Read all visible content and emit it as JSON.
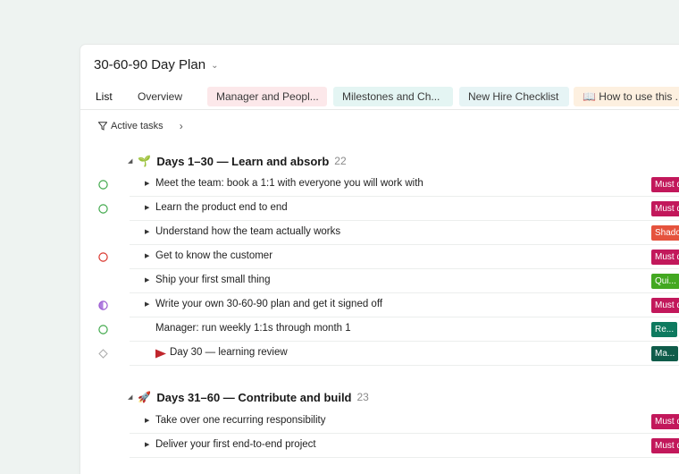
{
  "document": {
    "title": "30-60-90 Day Plan"
  },
  "tabs": [
    {
      "label": "List",
      "style": "active",
      "bg": ""
    },
    {
      "label": "Overview",
      "style": "plain",
      "bg": ""
    },
    {
      "label": "Manager and Peopl...",
      "style": "pill",
      "bg": "#fce8ea"
    },
    {
      "label": "Milestones and Ch...",
      "style": "pill",
      "bg": "#e4f5f3"
    },
    {
      "label": "New Hire Checklist",
      "style": "pill",
      "bg": "#e6f4f5"
    },
    {
      "label": "📖 How to use this ...",
      "style": "pill",
      "bg": "#fdf0e0"
    }
  ],
  "filter": {
    "label": "Active tasks",
    "more": "›"
  },
  "groups": [
    {
      "emoji": "🌱",
      "title": "Days 1–30 — Learn and absorb",
      "count": "22"
    },
    {
      "emoji": "🚀",
      "title": "Days 31–60 — Contribute and build",
      "count": "23"
    }
  ],
  "rows": [
    {
      "label": "Meet the team: book a 1:1 with everyone you will work with",
      "status": "open-green",
      "caret": true,
      "flag": false,
      "tag": "Must do",
      "tag_color": "#c2185b"
    },
    {
      "label": "Learn the product end to end",
      "status": "open-green",
      "caret": true,
      "flag": false,
      "tag": "Must do",
      "tag_color": "#c2185b"
    },
    {
      "label": "Understand how the team actually works",
      "status": "none",
      "caret": true,
      "flag": false,
      "tag": "Shadow",
      "tag_color": "#e5533d"
    },
    {
      "label": "Get to know the customer",
      "status": "open-red",
      "caret": true,
      "flag": false,
      "tag": "Must do",
      "tag_color": "#c2185b"
    },
    {
      "label": "Ship your first small thing",
      "status": "none",
      "caret": true,
      "flag": false,
      "tag": "Qui...",
      "tag_color": "#43a821"
    },
    {
      "label": "Write your own 30-60-90 plan and get it signed off",
      "status": "half-purple",
      "caret": true,
      "flag": false,
      "tag": "Must do",
      "tag_color": "#c2185b"
    },
    {
      "label": "Manager: run weekly 1:1s through month 1",
      "status": "open-green",
      "caret": false,
      "flag": false,
      "tag": "Re...",
      "tag_color": "#0e7a5f"
    },
    {
      "label": "Day 30 — learning review",
      "status": "diamond",
      "caret": false,
      "flag": true,
      "tag": "Ma...",
      "tag_color": "#0f5c4a"
    },
    {
      "label": "Take over one recurring responsibility",
      "status": "none",
      "caret": true,
      "flag": false,
      "tag": "Must do",
      "tag_color": "#c2185b"
    },
    {
      "label": "Deliver your first end-to-end project",
      "status": "none",
      "caret": true,
      "flag": false,
      "tag": "Must do",
      "tag_color": "#c2185b"
    }
  ]
}
